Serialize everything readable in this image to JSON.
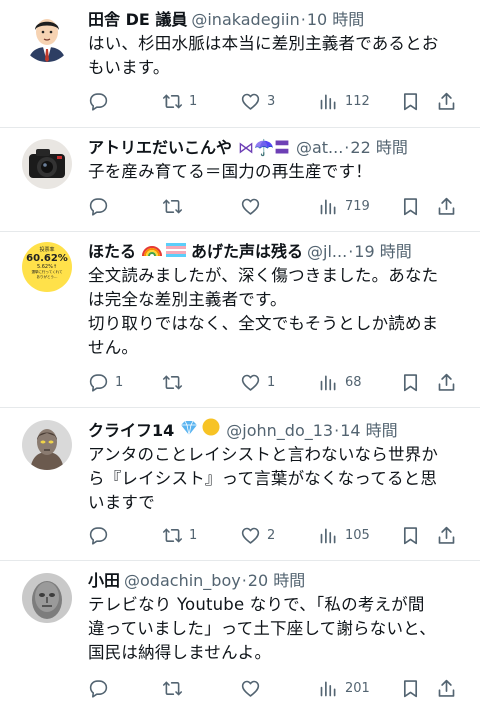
{
  "tweets": [
    {
      "name": "田舎 DE 議員",
      "handle": "@inakadegiin",
      "time": "10 時間",
      "lines": [
        "はい、杉田水脈は本当に差別主義者であるとお",
        "もいます。"
      ],
      "replies": "",
      "retweets": "1",
      "likes": "3",
      "views": "112"
    },
    {
      "name": "アトリエだいこんや",
      "name_emojis": "⋈☂️〓",
      "handle": "@at...",
      "time": "22 時間",
      "lines": [
        "子を産み育てる＝国力の再生産です！"
      ],
      "replies": "",
      "retweets": "",
      "likes": "",
      "views": "719"
    },
    {
      "name": "ほたる",
      "name_suffix": "あげた声は残る",
      "handle": "@jl...",
      "time": "19 時間",
      "avatar_text": [
        "投票率",
        "60.62%",
        "5.62%↑",
        "選挙に行ってくれて",
        "ありがとう…"
      ],
      "lines": [
        "全文読みましたが、深く傷つきました。あなた",
        "は完全な差別主義者です。",
        "切り取りではなく、全文でもそうとしか読めま",
        "せん。"
      ],
      "replies": "1",
      "retweets": "",
      "likes": "1",
      "views": "68"
    },
    {
      "name": "クライフ14",
      "handle": "@john_do_13",
      "time": "14 時間",
      "lines": [
        "アンタのことレイシストと言わないなら世界か",
        "ら『レイシスト』って言葉がなくなってると思",
        "いますで"
      ],
      "replies": "",
      "retweets": "1",
      "likes": "2",
      "views": "105"
    },
    {
      "name": "小田",
      "handle": "@odachin_boy",
      "time": "20 時間",
      "lines": [
        "テレビなり Youtube なりで、「私の考えが間",
        "違っていました」って土下座して謝らないと、",
        "国民は納得しませんよ。"
      ],
      "replies": "",
      "retweets": "",
      "likes": "",
      "views": "201"
    }
  ],
  "colors": {
    "text": "#0f1419",
    "secondary": "#536471",
    "divider": "#e6e9eb"
  },
  "icons": [
    "reply-icon",
    "retweet-icon",
    "like-icon",
    "views-icon",
    "bookmark-icon",
    "share-icon"
  ]
}
